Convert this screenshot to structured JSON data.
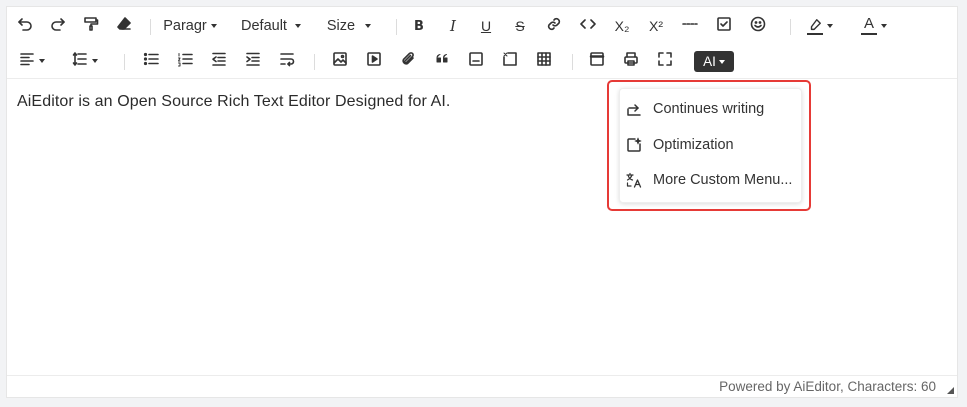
{
  "toolbar": {
    "row1": {
      "undo_icon": "undo-icon",
      "redo_icon": "redo-icon",
      "format_painter_icon": "format-painter-icon",
      "eraser_icon": "eraser-icon",
      "heading_select": "Paragr",
      "font_family_select": "Default",
      "font_size_select": "Size",
      "bold": "B",
      "italic": "I",
      "underline": "U",
      "strike": "S",
      "subscript": "X₂",
      "superscript": "X²",
      "highlight_color": "#333333",
      "font_color_label": "A",
      "font_color": "#333333"
    },
    "row2": {
      "ai_label": "AI"
    }
  },
  "content": {
    "text": "AiEditor is an Open Source Rich Text Editor Designed for AI."
  },
  "ai_menu": {
    "items": [
      {
        "label": "Continues writing",
        "icon": "continue-writing-icon"
      },
      {
        "label": "Optimization",
        "icon": "optimization-icon"
      },
      {
        "label": "More Custom Menu...",
        "icon": "translate-icon"
      }
    ],
    "highlight_color": "#e63a36"
  },
  "footer": {
    "status": "Powered by AiEditor, Characters: 60"
  }
}
